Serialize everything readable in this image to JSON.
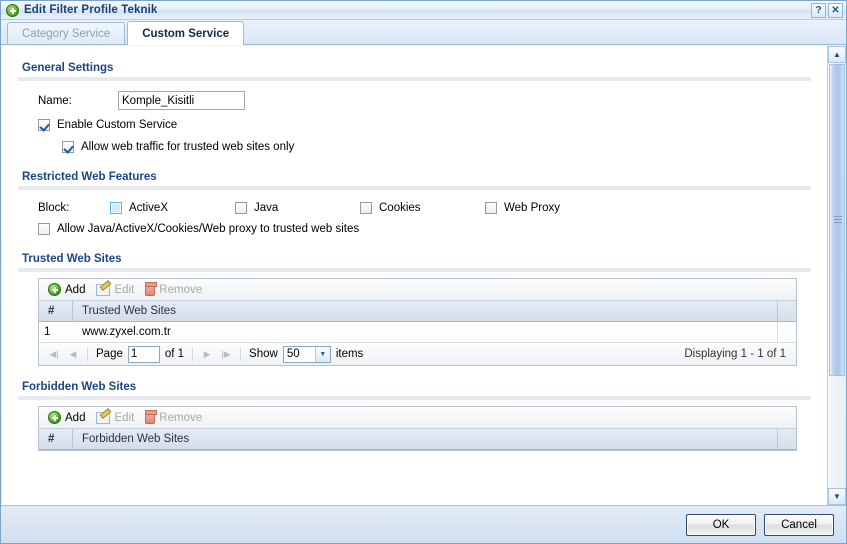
{
  "window": {
    "title": "Edit Filter Profile Teknik",
    "title_icon": "add-circle-icon",
    "help_label": "?",
    "close_label": "✕"
  },
  "tabs": [
    {
      "label": "Category Service",
      "active": false
    },
    {
      "label": "Custom Service",
      "active": true
    }
  ],
  "sections": {
    "general": {
      "title": "General Settings",
      "name_label": "Name:",
      "name_value": "Komple_Kisitli",
      "name_placeholder": "",
      "enable_custom_service": {
        "label": "Enable Custom Service",
        "checked": true
      },
      "allow_trusted_only": {
        "label": "Allow web traffic for trusted web sites only",
        "checked": true
      }
    },
    "restricted": {
      "title": "Restricted Web Features",
      "block_label": "Block:",
      "items": [
        {
          "label": "ActiveX",
          "checked": false,
          "focused": true
        },
        {
          "label": "Java",
          "checked": false,
          "focused": false
        },
        {
          "label": "Cookies",
          "checked": false,
          "focused": false
        },
        {
          "label": "Web Proxy",
          "checked": false,
          "focused": false
        }
      ],
      "allow_trusted": {
        "label": "Allow Java/ActiveX/Cookies/Web proxy to trusted web sites",
        "checked": false
      }
    },
    "trusted": {
      "title": "Trusted Web Sites",
      "toolbar": {
        "add": "Add",
        "edit": "Edit",
        "remove": "Remove"
      },
      "columns": [
        "#",
        "Trusted Web Sites"
      ],
      "rows": [
        {
          "num": "1",
          "site": "www.zyxel.com.tr"
        }
      ],
      "pager": {
        "first": "◀|",
        "prev": "◀",
        "page_label": "Page",
        "page_value": "1",
        "of_label": "of 1",
        "next": "▶",
        "last": "|▶",
        "show_label": "Show",
        "show_value": "50",
        "items_label": "items",
        "displaying": "Displaying 1 - 1 of 1"
      }
    },
    "forbidden": {
      "title": "Forbidden Web Sites",
      "toolbar": {
        "add": "Add",
        "edit": "Edit",
        "remove": "Remove"
      },
      "columns": [
        "#",
        "Forbidden Web Sites"
      ]
    }
  },
  "scrollbar": {
    "up": "▲",
    "down": "▼"
  },
  "footer": {
    "ok": "OK",
    "cancel": "Cancel"
  },
  "colors": {
    "heading": "#1b4584",
    "title": "#1c3f73",
    "accent_green": "#57b42f",
    "accent_red": "#e08878"
  }
}
